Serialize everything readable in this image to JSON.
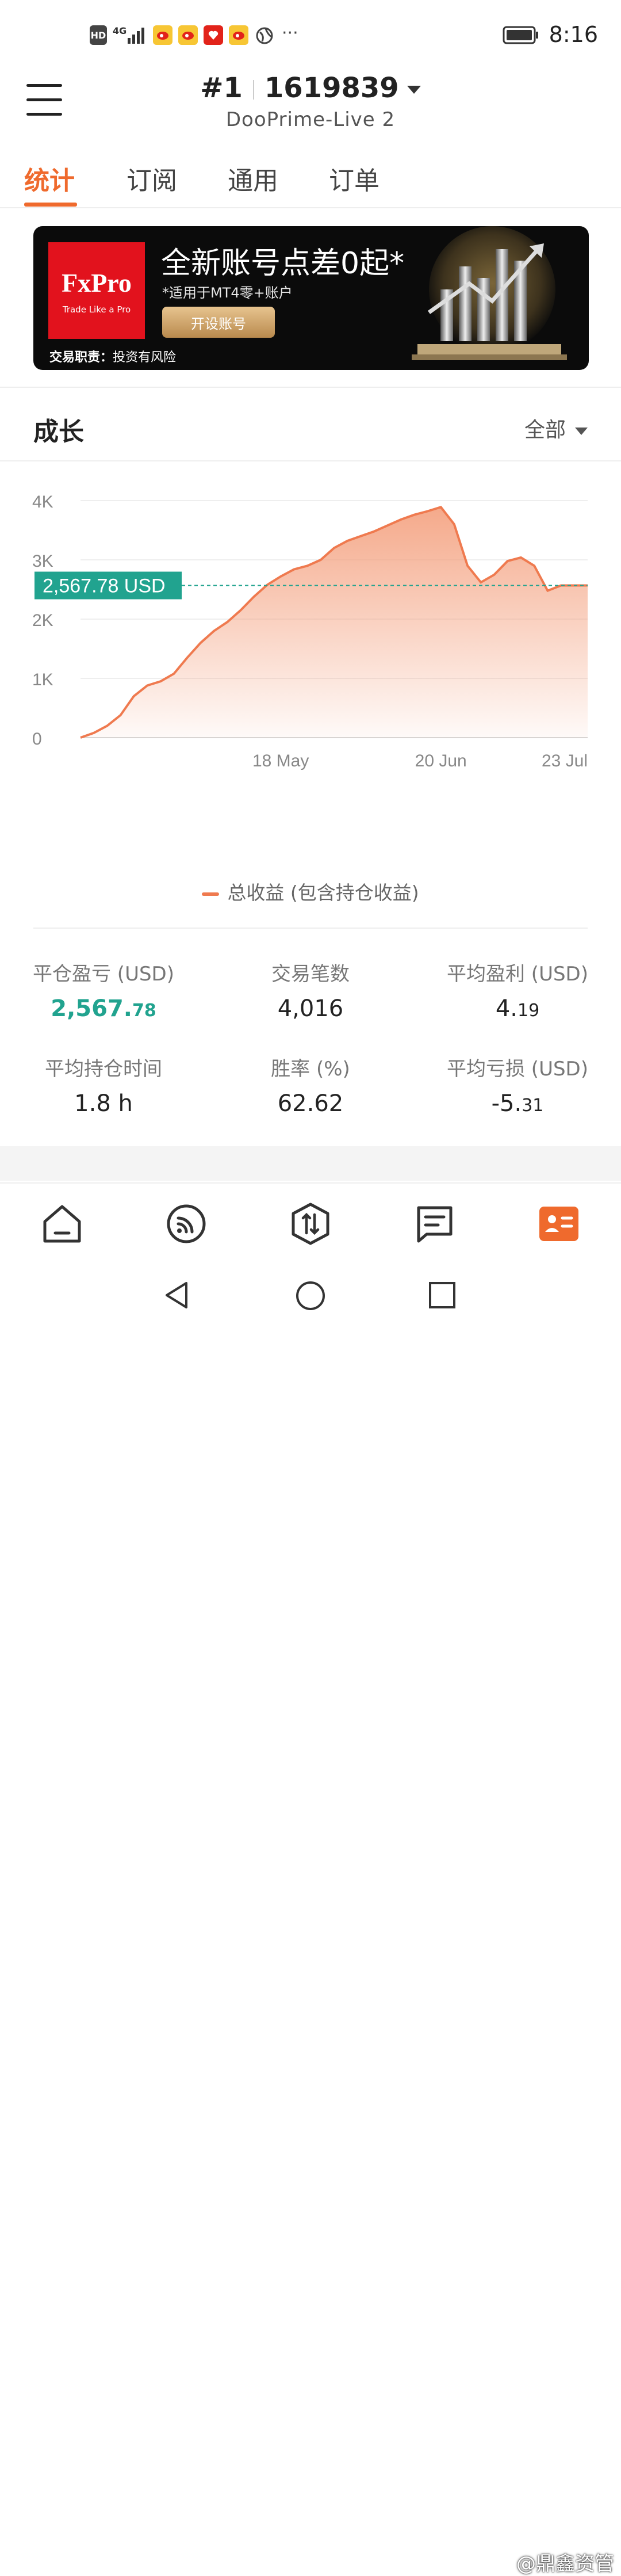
{
  "status_bar": {
    "time": "8:16",
    "signal": "4G",
    "hd": "HD",
    "more": "···",
    "icons": [
      "hd-icon",
      "signal-icon",
      "weibo-icon",
      "weibo-icon",
      "red-app-icon",
      "weibo-icon",
      "globe-icon",
      "more-icon",
      "battery-icon"
    ]
  },
  "header": {
    "account_index": "#1",
    "account_number": "1619839",
    "server": "DooPrime-Live 2"
  },
  "tabs": [
    {
      "label": "统计",
      "active": true
    },
    {
      "label": "订阅",
      "active": false
    },
    {
      "label": "通用",
      "active": false
    },
    {
      "label": "订单",
      "active": false
    }
  ],
  "banner": {
    "brand": "FxPro",
    "brand_tagline": "Trade Like a Pro",
    "title": "全新账号点差0起*",
    "subtitle": "*适用于MT4零+账户",
    "button": "开设账号",
    "risk_label": "交易职责：",
    "risk_text": "投资有风险"
  },
  "growth": {
    "title": "成长",
    "period": "全部"
  },
  "chart_data": {
    "type": "area",
    "y_ticks": [
      "4K",
      "3K",
      "2K",
      "1K",
      "0"
    ],
    "ylim": [
      0,
      4000
    ],
    "x_ticks": [
      "18 May",
      "20 Jun",
      "23 Jul"
    ],
    "current_value_label": "2,567.78 USD",
    "current_value": 2567.78,
    "series": [
      {
        "name": "总收益 (包含持仓收益)",
        "color": "#ef7a4f",
        "x": [
          "Apr 12",
          "Apr 15",
          "Apr 18",
          "Apr 21",
          "Apr 23",
          "Apr 24",
          "Apr 27",
          "Apr 30",
          "May 3",
          "May 6",
          "May 8",
          "May 11",
          "May 14",
          "May 17",
          "May 20",
          "May 23",
          "May 26",
          "May 29",
          "Jun 1",
          "Jun 4",
          "Jun 7",
          "Jun 10",
          "Jun 13",
          "Jun 16",
          "Jun 19",
          "Jun 22",
          "Jun 25",
          "Jun 28",
          "Jun 30",
          "Jul 1",
          "Jul 3",
          "Jul 5",
          "Jul 8",
          "Jul 11",
          "Jul 14",
          "Jul 16",
          "Jul 18",
          "Jul 20",
          "Jul 23"
        ],
        "values": [
          0,
          80,
          200,
          380,
          700,
          880,
          950,
          1080,
          1350,
          1600,
          1800,
          1950,
          2150,
          2380,
          2580,
          2720,
          2840,
          2900,
          3000,
          3200,
          3320,
          3400,
          3480,
          3580,
          3680,
          3760,
          3820,
          3890,
          3600,
          2900,
          2620,
          2750,
          2980,
          3040,
          2900,
          2480,
          2567.78,
          2567.78,
          2567.78
        ]
      }
    ],
    "grid": true
  },
  "legend": {
    "label": "总收益 (包含持仓收益)"
  },
  "stats": [
    {
      "label": "平仓盈亏 (USD)",
      "int": "2,567.",
      "dec": "78",
      "highlight": true
    },
    {
      "label": "交易笔数",
      "int": "4,016",
      "dec": "",
      "highlight": false
    },
    {
      "label": "平均盈利 (USD)",
      "int": "4.",
      "dec": "19",
      "highlight": false
    },
    {
      "label": "平均持仓时间",
      "int": "1.8 h",
      "dec": "",
      "highlight": false
    },
    {
      "label": "胜率 (%)",
      "int": "62.62",
      "dec": "",
      "highlight": false
    },
    {
      "label": "平均亏损 (USD)",
      "int": "-5.",
      "dec": "31",
      "highlight": false
    }
  ],
  "bottom_nav": [
    "home-icon",
    "signal-feed-icon",
    "trade-icon",
    "messages-icon",
    "account-icon"
  ],
  "watermark": "@鼎鑫资管"
}
